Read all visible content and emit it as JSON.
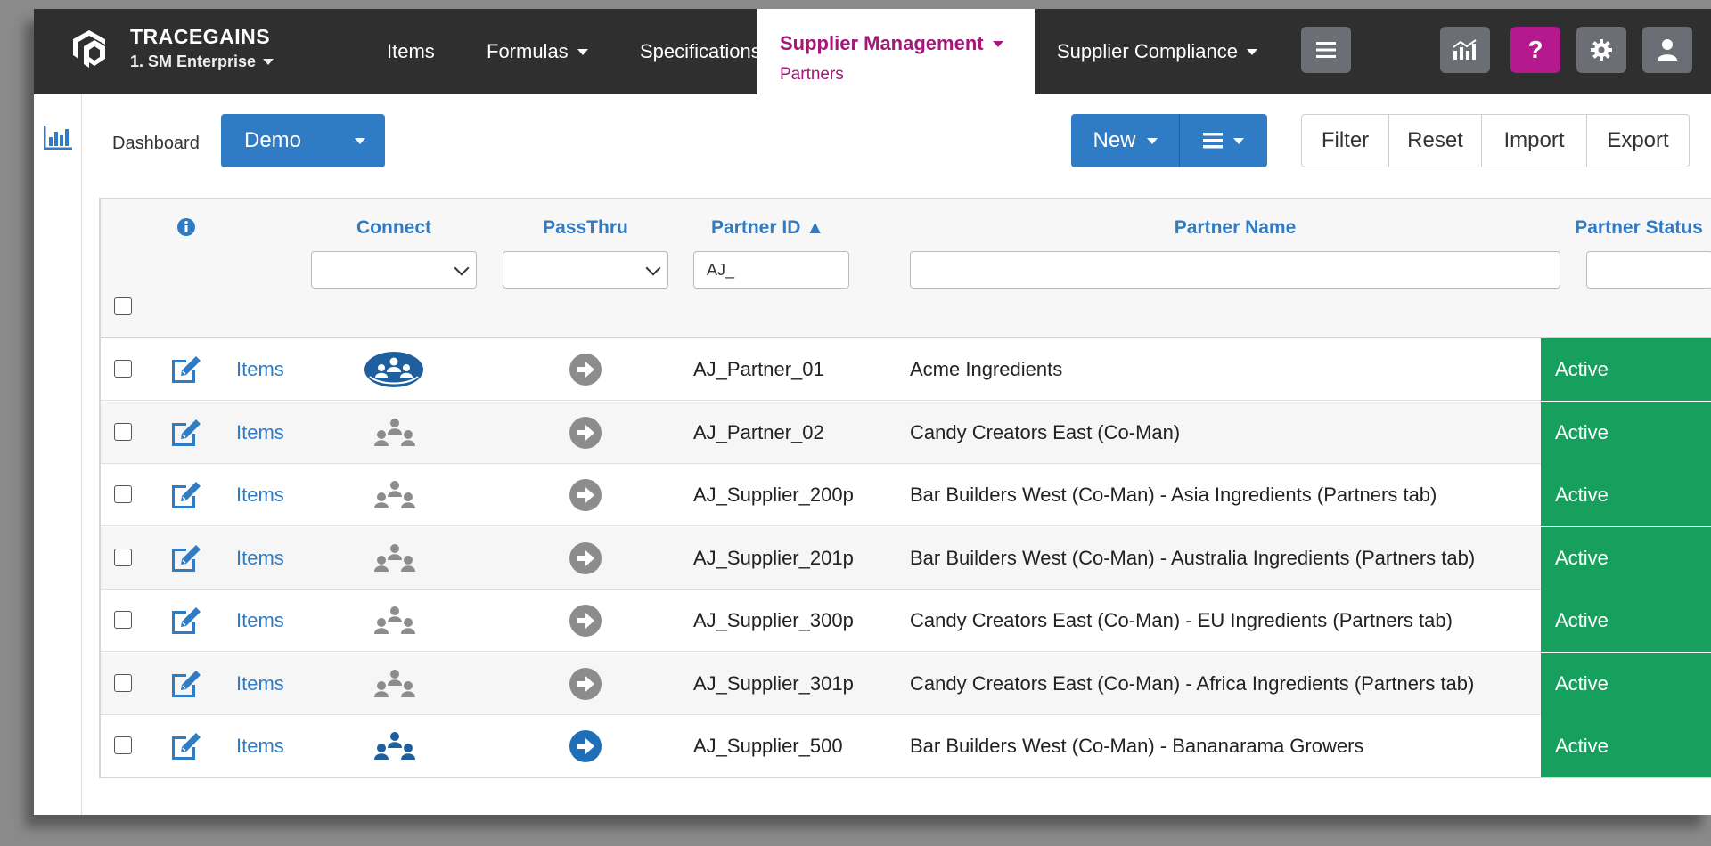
{
  "brand": {
    "name": "TRACEGAINS",
    "org": "1. SM Enterprise"
  },
  "nav": {
    "items": {
      "label": "Items"
    },
    "formulas": {
      "label": "Formulas"
    },
    "specifications": {
      "label": "Specifications"
    },
    "supplier_management": {
      "label": "Supplier Management",
      "sub": "Partners"
    },
    "supplier_compliance": {
      "label": "Supplier Compliance"
    }
  },
  "toolbar": {
    "dashboard_label": "Dashboard",
    "dashboard_value": "Demo",
    "new_label": "New",
    "filter_label": "Filter",
    "reset_label": "Reset",
    "import_label": "Import",
    "export_label": "Export"
  },
  "table": {
    "headers": {
      "connect": "Connect",
      "passthru": "PassThru",
      "partner_id": "Partner ID ▲",
      "partner_name": "Partner Name",
      "partner_status": "Partner Status"
    },
    "filters": {
      "partner_id": "AJ_",
      "partner_name": "",
      "partner_status": ""
    },
    "rows": [
      {
        "link": "Items",
        "id": "AJ_Partner_01",
        "name": "Acme Ingredients",
        "status": "Active",
        "connect": "connected-circle",
        "passthru_active": false
      },
      {
        "link": "Items",
        "id": "AJ_Partner_02",
        "name": "Candy Creators East (Co-Man)",
        "status": "Active",
        "connect": "grey",
        "passthru_active": false
      },
      {
        "link": "Items",
        "id": "AJ_Supplier_200p",
        "name": "Bar Builders West (Co-Man) - Asia Ingredients (Partners tab)",
        "status": "Active",
        "connect": "grey",
        "passthru_active": false
      },
      {
        "link": "Items",
        "id": "AJ_Supplier_201p",
        "name": "Bar Builders West (Co-Man) - Australia Ingredients (Partners tab)",
        "status": "Active",
        "connect": "grey",
        "passthru_active": false
      },
      {
        "link": "Items",
        "id": "AJ_Supplier_300p",
        "name": "Candy Creators East (Co-Man) - EU Ingredients (Partners tab)",
        "status": "Active",
        "connect": "grey",
        "passthru_active": false
      },
      {
        "link": "Items",
        "id": "AJ_Supplier_301p",
        "name": "Candy Creators East (Co-Man) - Africa Ingredients (Partners tab)",
        "status": "Active",
        "connect": "grey",
        "passthru_active": false
      },
      {
        "link": "Items",
        "id": "AJ_Supplier_500",
        "name": "Bar Builders West (Co-Man) - Bananarama Growers",
        "status": "Active",
        "connect": "blue",
        "passthru_active": true
      }
    ]
  },
  "colors": {
    "accent": "#2f7bc4",
    "brand_magenta": "#a4187a",
    "status_active": "#17a05d",
    "nav_bg": "#2f2f2f",
    "icon_inactive": "#8c8c8c"
  }
}
